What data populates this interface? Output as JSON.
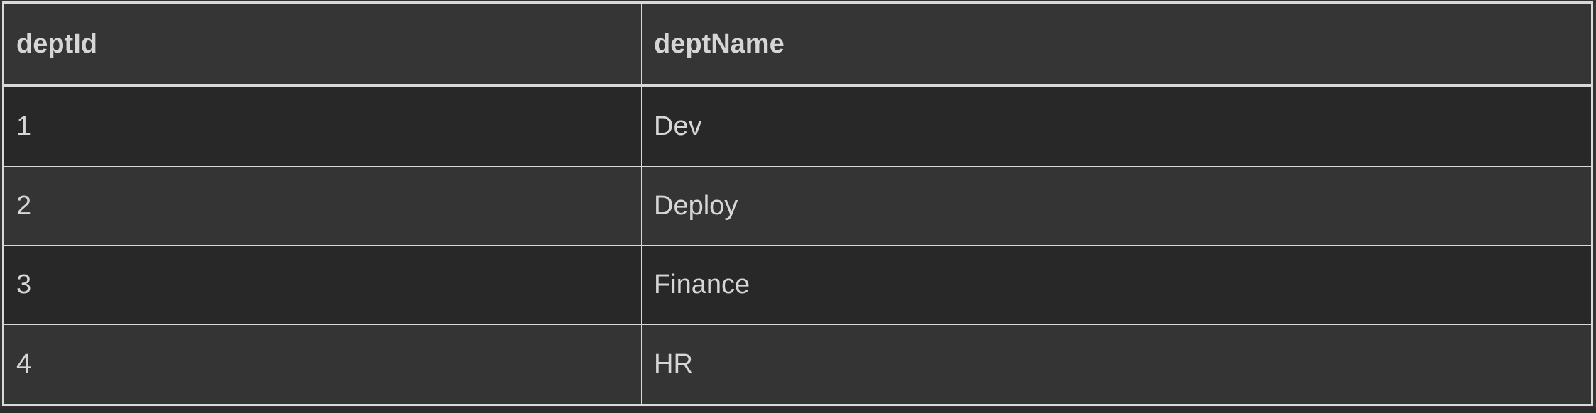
{
  "table": {
    "headers": [
      "deptId",
      "deptName"
    ],
    "rows": [
      [
        "1",
        "Dev"
      ],
      [
        "2",
        "Deploy"
      ],
      [
        "3",
        "Finance"
      ],
      [
        "4",
        "HR"
      ]
    ]
  },
  "colors": {
    "background": "#333333",
    "odd_row": "#282828",
    "even_row": "#343434",
    "border": "#d9d9d9",
    "text": "#d6d6d6"
  }
}
